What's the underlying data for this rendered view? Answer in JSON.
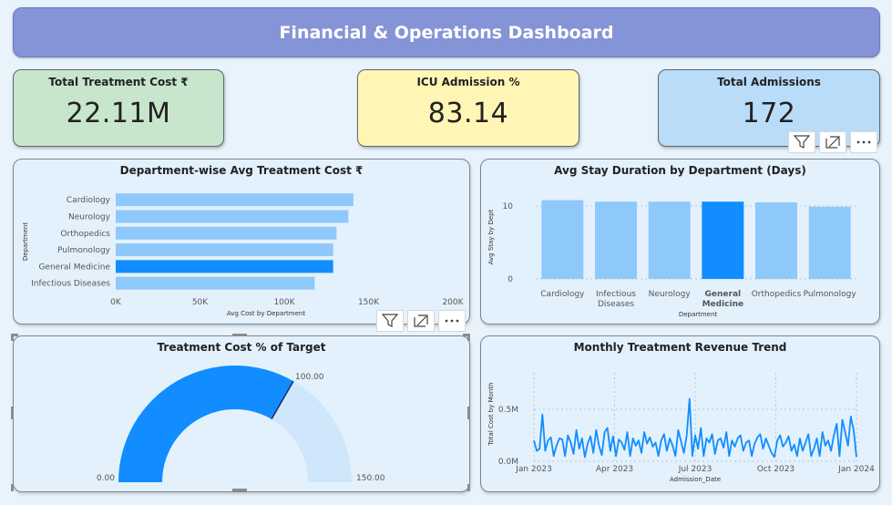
{
  "header": {
    "title": "Financial & Operations Dashboard"
  },
  "kpis": [
    {
      "label": "Total Treatment Cost ₹",
      "value": "22.11M",
      "color": "#c8e6cc"
    },
    {
      "label": "ICU Admission %",
      "value": "83.14",
      "color": "#fff6b5"
    },
    {
      "label": "Total Admissions",
      "value": "172",
      "color": "#b9dcf9"
    }
  ],
  "visual_toolbar": {
    "icons": [
      "filter-icon",
      "focus-mode-icon",
      "more-options-icon"
    ]
  },
  "colors": {
    "bar": "#8fc8fb",
    "highlight": "#118dff",
    "line": "#118dff"
  },
  "chart_data": [
    {
      "type": "bar",
      "orientation": "horizontal",
      "title": "Department-wise Avg Treatment Cost ₹",
      "categories": [
        "Cardiology",
        "Neurology",
        "Orthopedics",
        "Pulmonology",
        "General Medicine",
        "Infectious Diseases"
      ],
      "values": [
        141000,
        138000,
        131000,
        129000,
        129000,
        118000
      ],
      "highlight": "General Medicine",
      "xlabel": "Avg Cost by Department",
      "ylabel": "Department",
      "xlim": [
        0,
        200000
      ],
      "xticks": [
        "0K",
        "50K",
        "100K",
        "150K",
        "200K"
      ],
      "grid": false
    },
    {
      "type": "bar",
      "title": "Avg Stay Duration by Department (Days)",
      "categories": [
        "Cardiology",
        "Infectious Diseases",
        "Neurology",
        "General Medicine",
        "Orthopedics",
        "Pulmonology"
      ],
      "category_lines": [
        [
          "Cardiology"
        ],
        [
          "Infectious",
          "Diseases"
        ],
        [
          "Neurology"
        ],
        [
          "General",
          "Medicine"
        ],
        [
          "Orthopedics"
        ],
        [
          "Pulmonology"
        ]
      ],
      "values": [
        10.8,
        10.6,
        10.6,
        10.6,
        10.5,
        9.9
      ],
      "highlight": "General Medicine",
      "xlabel": "Department",
      "ylabel": "Avg Stay by Dept",
      "ylim": [
        0,
        12
      ],
      "yticks": [
        "0",
        "10"
      ],
      "grid": true
    },
    {
      "type": "gauge",
      "title": "Treatment Cost % of Target",
      "value": 100,
      "min": 0,
      "max": 150,
      "target": 100,
      "min_label": "0.00",
      "max_label": "150.00",
      "target_label": "100.00"
    },
    {
      "type": "line",
      "title": "Monthly Treatment Revenue Trend",
      "xlabel": "Admission_Date",
      "ylabel": "Total Cost by Month",
      "ylim": [
        0,
        0.85
      ],
      "yticks": [
        "0.0M",
        "0.5M"
      ],
      "xticks": [
        "Jan 2023",
        "Apr 2023",
        "Jul 2023",
        "Oct 2023",
        "Jan 2024"
      ],
      "x_range": [
        "2023-01-01",
        "2024-01-01"
      ],
      "grid": true,
      "unit": "M",
      "values": [
        0.2,
        0.1,
        0.12,
        0.45,
        0.1,
        0.2,
        0.23,
        0.05,
        0.15,
        0.22,
        0.21,
        0.05,
        0.25,
        0.18,
        0.07,
        0.3,
        0.12,
        0.22,
        0.04,
        0.17,
        0.24,
        0.08,
        0.3,
        0.15,
        0.06,
        0.28,
        0.32,
        0.1,
        0.24,
        0.05,
        0.21,
        0.18,
        0.11,
        0.28,
        0.05,
        0.22,
        0.15,
        0.2,
        0.08,
        0.28,
        0.17,
        0.23,
        0.14,
        0.18,
        0.05,
        0.2,
        0.26,
        0.1,
        0.22,
        0.15,
        0.05,
        0.3,
        0.19,
        0.08,
        0.25,
        0.6,
        0.05,
        0.25,
        0.12,
        0.32,
        0.05,
        0.22,
        0.18,
        0.26,
        0.07,
        0.2,
        0.22,
        0.13,
        0.28,
        0.05,
        0.2,
        0.14,
        0.22,
        0.25,
        0.1,
        0.18,
        0.2,
        0.05,
        0.17,
        0.23,
        0.26,
        0.12,
        0.22,
        0.15,
        0.08,
        0.04,
        0.2,
        0.25,
        0.14,
        0.18,
        0.24,
        0.1,
        0.16,
        0.05,
        0.22,
        0.1,
        0.18,
        0.26,
        0.05,
        0.12,
        0.22,
        0.05,
        0.28,
        0.15,
        0.2,
        0.1,
        0.25,
        0.36,
        0.05,
        0.4,
        0.28,
        0.15,
        0.43,
        0.3,
        0.04
      ]
    }
  ]
}
